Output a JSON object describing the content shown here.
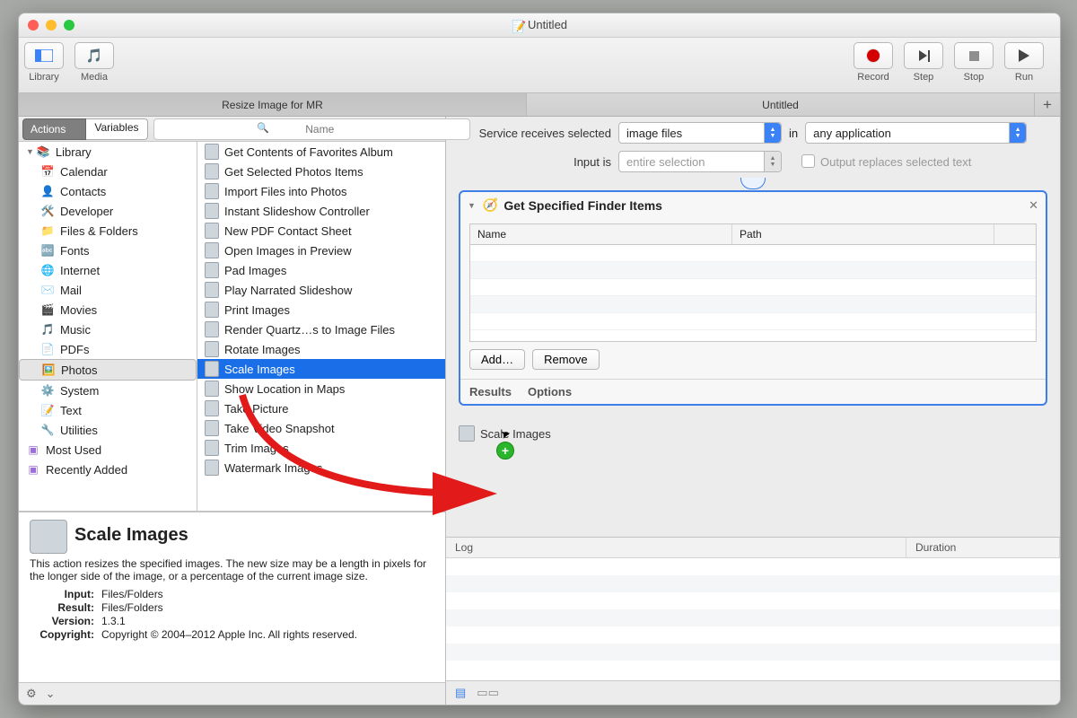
{
  "window": {
    "title": "Untitled"
  },
  "toolbar": {
    "library": "Library",
    "media": "Media",
    "record": "Record",
    "step": "Step",
    "stop": "Stop",
    "run": "Run"
  },
  "tabs": {
    "left": "Resize Image for MR",
    "right": "Untitled",
    "plus": "+"
  },
  "segmented": {
    "actions": "Actions",
    "variables": "Variables"
  },
  "search": {
    "placeholder": "Name"
  },
  "library": {
    "root": "Library",
    "items": [
      "Calendar",
      "Contacts",
      "Developer",
      "Files & Folders",
      "Fonts",
      "Internet",
      "Mail",
      "Movies",
      "Music",
      "PDFs",
      "Photos",
      "System",
      "Text",
      "Utilities"
    ],
    "selected_index": 10,
    "extras": [
      "Most Used",
      "Recently Added"
    ]
  },
  "actions_list": {
    "items": [
      "Get Contents of Favorites Album",
      "Get Selected Photos Items",
      "Import Files into Photos",
      "Instant Slideshow Controller",
      "New PDF Contact Sheet",
      "Open Images in Preview",
      "Pad Images",
      "Play Narrated Slideshow",
      "Print Images",
      "Render Quartz…s to Image Files",
      "Rotate Images",
      "Scale Images",
      "Show Location in Maps",
      "Take Picture",
      "Take Video Snapshot",
      "Trim Images",
      "Watermark Images"
    ],
    "selected_index": 11
  },
  "description": {
    "title": "Scale Images",
    "body": "This action resizes the specified images. The new size may be a length in pixels for the longer side of the image, or a percentage of the current image size.",
    "input_label": "Input:",
    "input_value": "Files/Folders",
    "result_label": "Result:",
    "result_value": "Files/Folders",
    "version_label": "Version:",
    "version_value": "1.3.1",
    "copyright_label": "Copyright:",
    "copyright_value": "Copyright © 2004–2012 Apple Inc.  All rights reserved."
  },
  "config": {
    "receives_label": "Service receives selected",
    "receives_value": "image files",
    "in_label": "in",
    "in_value": "any application",
    "inputis_label": "Input is",
    "inputis_value": "entire selection",
    "output_checkbox": "Output replaces selected text"
  },
  "flow_action": {
    "title": "Get Specified Finder Items",
    "col_name": "Name",
    "col_path": "Path",
    "add": "Add…",
    "remove": "Remove",
    "results": "Results",
    "options": "Options"
  },
  "drag_item": {
    "label": "Scale Images"
  },
  "log": {
    "header_log": "Log",
    "header_duration": "Duration"
  },
  "footer": {
    "gear": "⚙︎",
    "expand": "⌄"
  }
}
